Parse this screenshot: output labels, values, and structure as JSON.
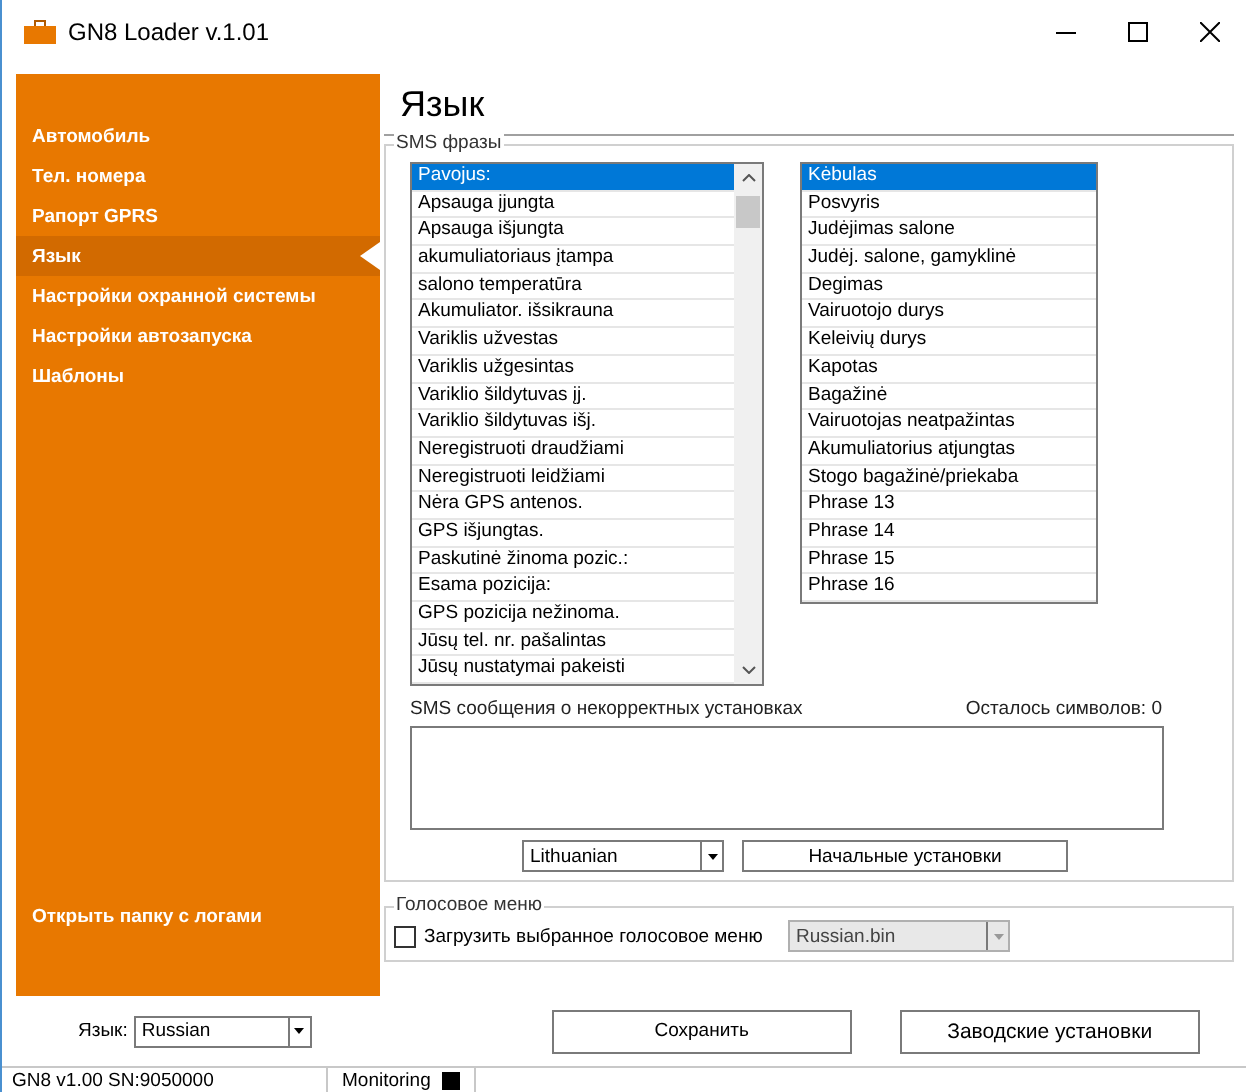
{
  "window": {
    "title": "GN8 Loader v.1.01"
  },
  "sidebar": {
    "items": [
      {
        "label": "Автомобиль",
        "selected": false
      },
      {
        "label": "Тел. номера",
        "selected": false
      },
      {
        "label": "Рапорт GPRS",
        "selected": false
      },
      {
        "label": "Язык",
        "selected": true
      },
      {
        "label": "Настройки охранной системы",
        "selected": false
      },
      {
        "label": "Настройки автозапуска",
        "selected": false
      },
      {
        "label": "Шаблоны",
        "selected": false
      }
    ],
    "logs_link": "Открыть папку с логами"
  },
  "page_title": "Язык",
  "sms_group": {
    "title": "SMS фразы",
    "left_list": [
      {
        "text": "Pavojus:",
        "selected": true
      },
      {
        "text": "Apsauga įjungta",
        "selected": false
      },
      {
        "text": "Apsauga išjungta",
        "selected": false
      },
      {
        "text": "akumuliatoriaus įtampa",
        "selected": false
      },
      {
        "text": "salono temperatūra",
        "selected": false
      },
      {
        "text": "Akumuliator. išsikrauna",
        "selected": false
      },
      {
        "text": "Variklis užvestas",
        "selected": false
      },
      {
        "text": "Variklis užgesintas",
        "selected": false
      },
      {
        "text": "Variklio šildytuvas įj.",
        "selected": false
      },
      {
        "text": "Variklio šildytuvas išj.",
        "selected": false
      },
      {
        "text": "Neregistruoti draudžiami",
        "selected": false
      },
      {
        "text": "Neregistruoti leidžiami",
        "selected": false
      },
      {
        "text": "Nėra GPS antenos.",
        "selected": false
      },
      {
        "text": "GPS išjungtas.",
        "selected": false
      },
      {
        "text": "Paskutinė žinoma pozic.:",
        "selected": false
      },
      {
        "text": "Esama pozicija:",
        "selected": false
      },
      {
        "text": "GPS pozicija nežinoma.",
        "selected": false
      },
      {
        "text": "Jūsų tel. nr. pašalintas",
        "selected": false
      },
      {
        "text": "Jūsų nustatymai pakeisti",
        "selected": false
      }
    ],
    "right_list": [
      {
        "text": "Kėbulas",
        "selected": true
      },
      {
        "text": "Posvyris",
        "selected": false
      },
      {
        "text": "Judėjimas salone",
        "selected": false
      },
      {
        "text": "Judėj. salone, gamyklinė",
        "selected": false
      },
      {
        "text": "Degimas",
        "selected": false
      },
      {
        "text": "Vairuotojo durys",
        "selected": false
      },
      {
        "text": "Keleivių durys",
        "selected": false
      },
      {
        "text": "Kapotas",
        "selected": false
      },
      {
        "text": "Bagažinė",
        "selected": false
      },
      {
        "text": "Vairuotojas neatpažintas",
        "selected": false
      },
      {
        "text": "Akumuliatorius atjungtas",
        "selected": false
      },
      {
        "text": "Stogo bagažinė/priekaba",
        "selected": false
      },
      {
        "text": "Phrase 13",
        "selected": false
      },
      {
        "text": "Phrase 14",
        "selected": false
      },
      {
        "text": "Phrase 15",
        "selected": false
      },
      {
        "text": "Phrase 16",
        "selected": false
      }
    ],
    "message_label": "SMS сообщения о некорректных установках",
    "remaining_label": "Осталось символов: 0",
    "language_select": "Lithuanian",
    "defaults_button": "Начальные установки"
  },
  "voice_group": {
    "title": "Голосовое меню",
    "checkbox": {
      "label": "Загрузить выбранное голосовое меню",
      "checked": false
    },
    "select": {
      "value": "Russian.bin",
      "disabled": true
    }
  },
  "bottom": {
    "language_label": "Язык:",
    "language_select": "Russian",
    "save_button": "Сохранить",
    "factory_button": "Заводские установки"
  },
  "status_bar": {
    "version": "GN8 v1.00 SN:9050000",
    "monitoring": "Monitoring"
  }
}
